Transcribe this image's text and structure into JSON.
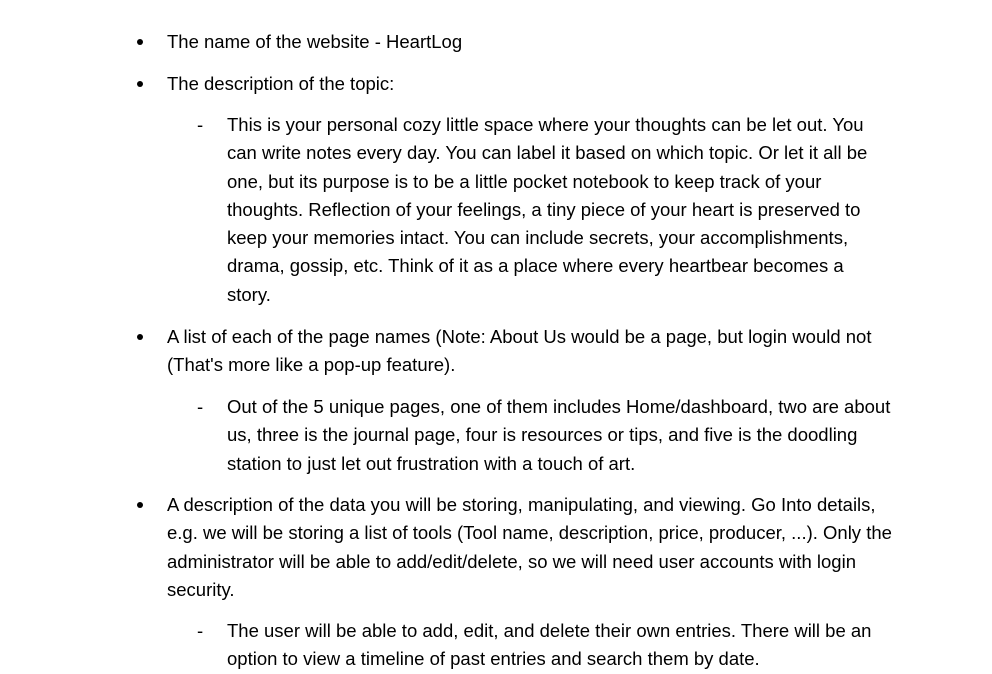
{
  "document": {
    "dash_symbol": "-",
    "items": [
      {
        "type": "bullet",
        "text": "The name of the website -  HeartLog"
      },
      {
        "type": "bullet",
        "text": "The description of  the  topic:"
      },
      {
        "type": "dash",
        "text": "This is your personal cozy little space where your thoughts can be let out. You can write notes every day. You can label it based on which topic. Or let it all be one, but its purpose is to be a little pocket notebook to keep track of your thoughts. Reflection of your feelings, a tiny piece of your heart is preserved to keep your memories intact. You can include secrets, your accomplishments, drama, gossip, etc. Think of it as a place where every heartbear becomes a story."
      },
      {
        "type": "bullet",
        "text": "A list of each of the page names (Note: About Us would be a page, but login would not (That's more like a pop-up feature)."
      },
      {
        "type": "dash",
        "text": "Out of the 5 unique pages, one of them includes Home/dashboard, two are about us, three is the journal page, four is resources or tips, and five is the doodling station to just let out frustration with a touch of art."
      },
      {
        "type": "bullet",
        "text": "A description of the data you will be storing, manipulating, and viewing. Go Into details, e.g. we will be storing a list of tools (Tool name, description, price, producer, ...). Only the administrator will be able to add/edit/delete, so we will need user accounts with login security."
      },
      {
        "type": "dash",
        "text": "The user will be able to add, edit, and delete their own entries. There will be an option to view a timeline of past entries and search them by date."
      }
    ]
  }
}
